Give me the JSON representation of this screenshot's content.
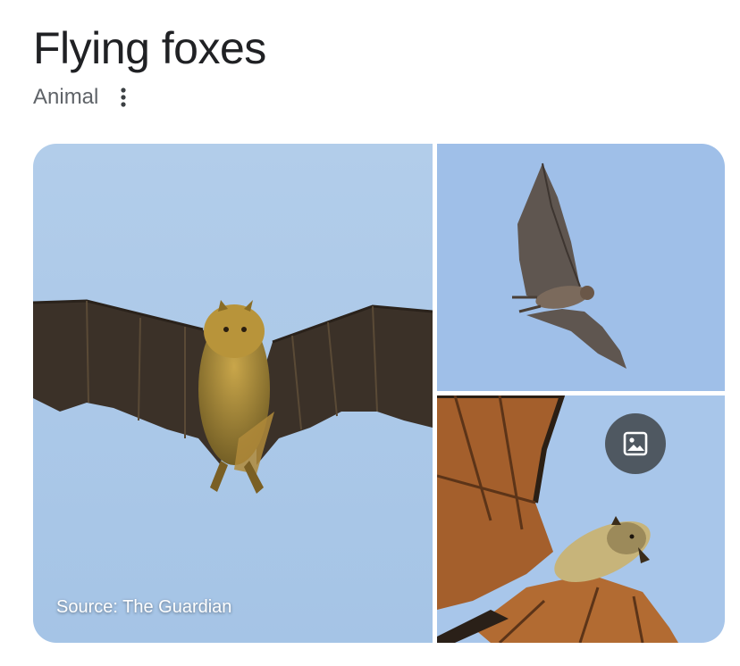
{
  "header": {
    "title": "Flying foxes",
    "subtitle": "Animal",
    "more_icon": "more-vert-icon"
  },
  "gallery": {
    "source_label": "Source: The Guardian",
    "images": [
      {
        "name": "main-image"
      },
      {
        "name": "top-right-image"
      },
      {
        "name": "bottom-right-image"
      }
    ],
    "image_button_icon": "image-icon"
  },
  "colors": {
    "sky": "#a9c8ea",
    "fur": "#9a7a2c",
    "wing": "#3a3530",
    "title": "#202124",
    "subtitle": "#5f6368"
  }
}
